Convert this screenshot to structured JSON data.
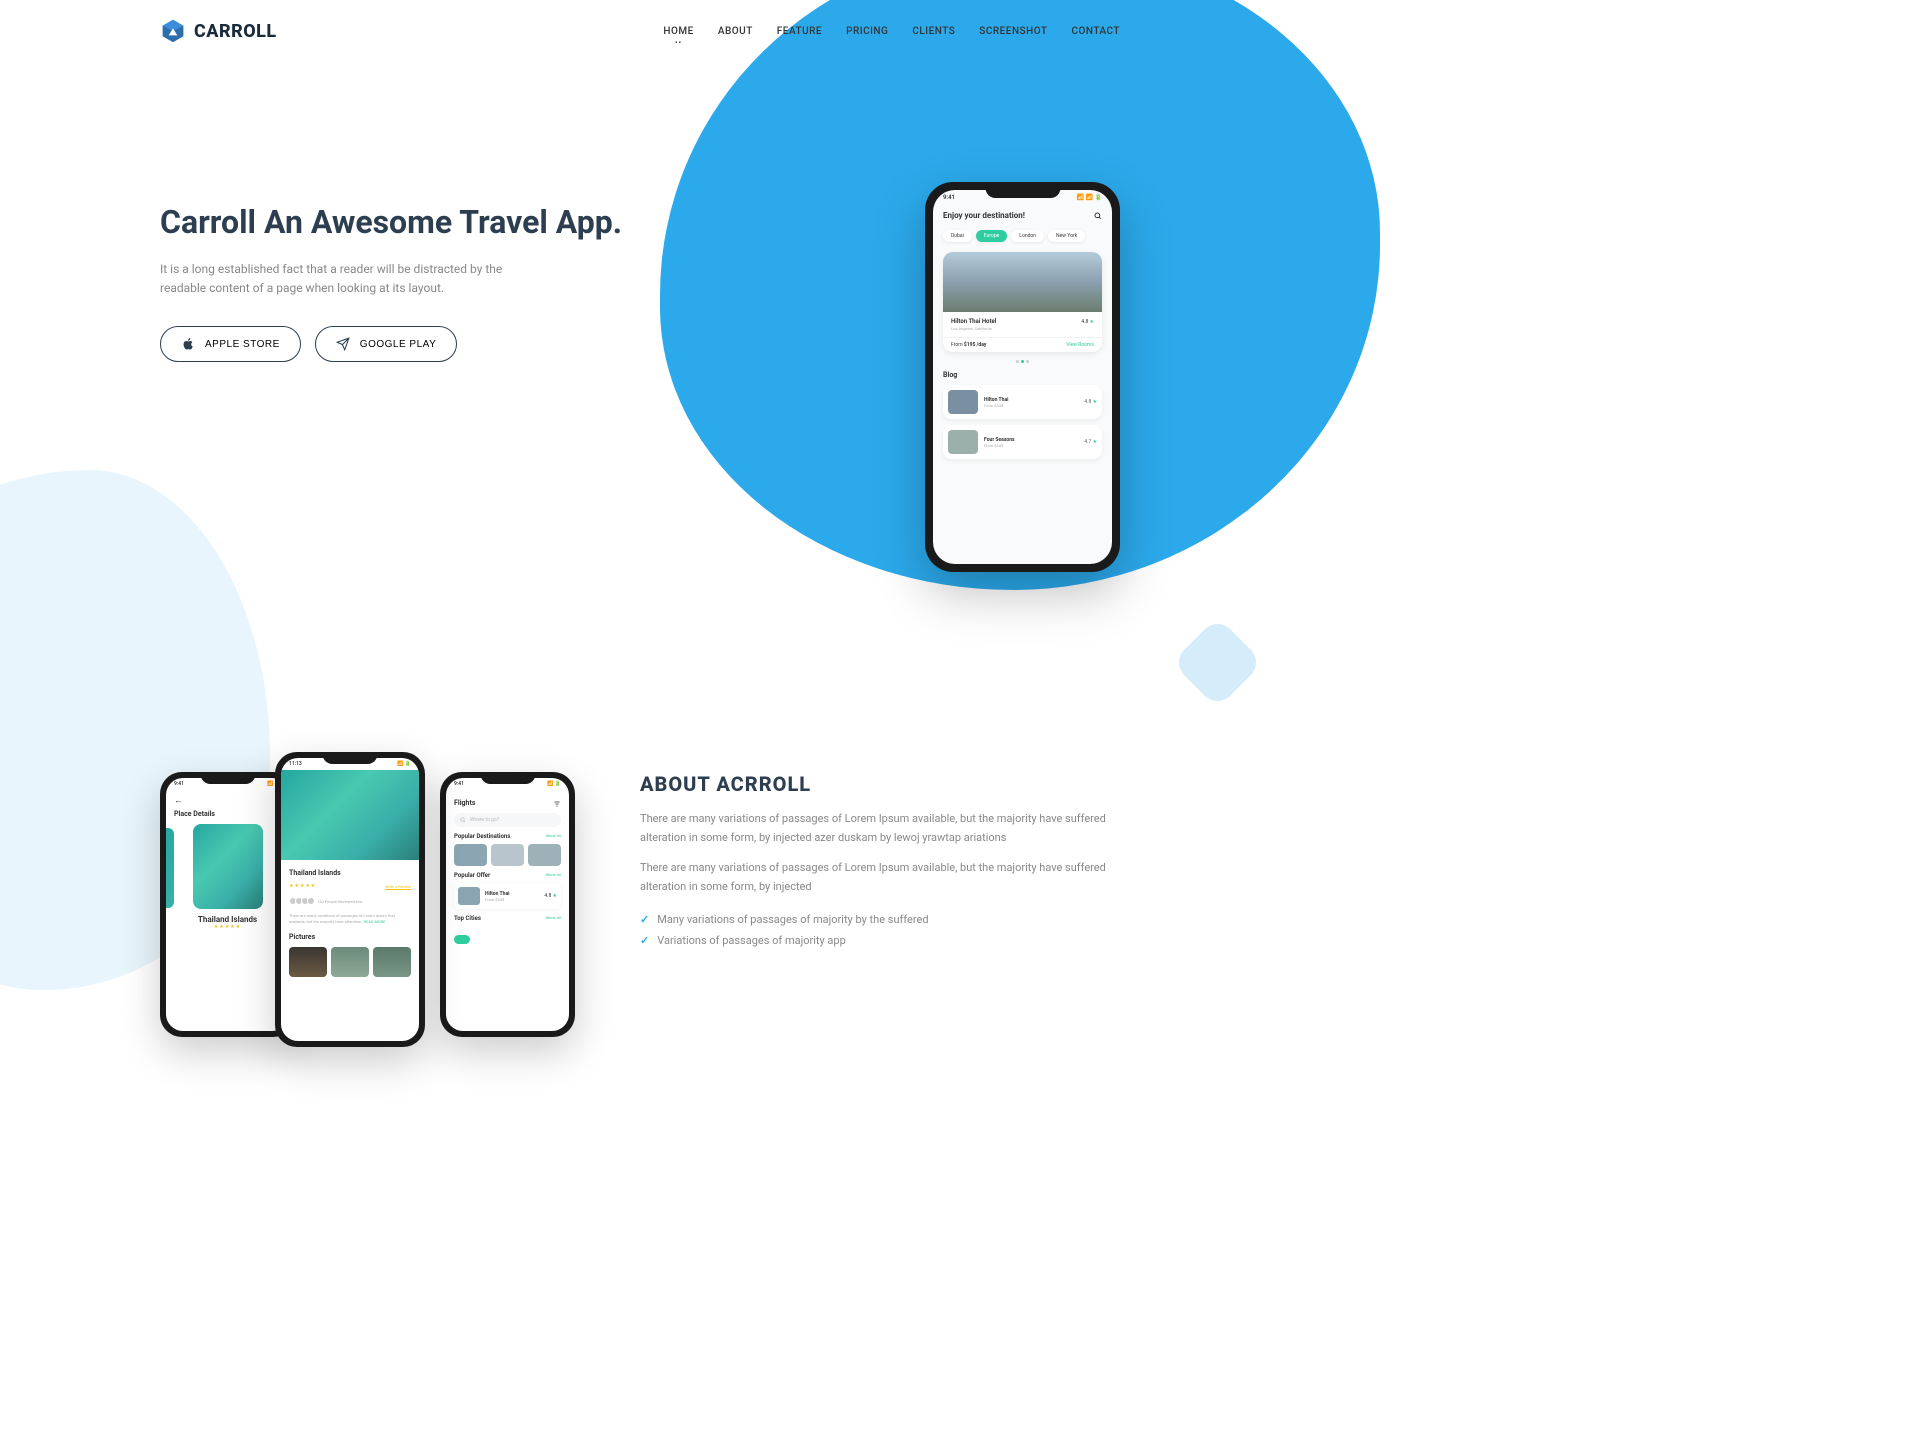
{
  "brand": "CARROLL",
  "nav": {
    "items": [
      "HOME",
      "ABOUT",
      "FEATURE",
      "PRICING",
      "CLIENTS",
      "SCREENSHOT",
      "CONTACT"
    ],
    "active": 0
  },
  "hero": {
    "title": "Carroll An Awesome Travel App.",
    "subtitle": "It is a long established fact that a reader will be distracted by the readable content of a page when looking at its layout.",
    "btn_apple": "APPLE STORE",
    "btn_google": "GOOGLE PLAY"
  },
  "phone1": {
    "time": "9:41",
    "heading": "Enjoy your destination!",
    "tabs": [
      "Dubai",
      "Europe",
      "London",
      "New York"
    ],
    "card": {
      "title": "Hilton Thai Hotel",
      "location": "Los Angeles, California",
      "rating": "4.8",
      "price_label": "From",
      "price": "$195 /day",
      "action": "View Rooms"
    },
    "blog_label": "Blog",
    "blog": [
      {
        "title": "Hilton Thai",
        "price": "From $345",
        "rating": "4.8"
      },
      {
        "title": "Four Seasons",
        "price": "From $345",
        "rating": "4.7"
      }
    ]
  },
  "about": {
    "title": "ABOUT ACRROLL",
    "p1": "There are many variations of passages of Lorem Ipsum available, but the majority have suffered alteration in some form, by injected azer duskam by lewoj yrawtap ariations",
    "p2": "There are many variations of passages of Lorem Ipsum available, but the majority have suffered alteration in some form, by injected",
    "items": [
      "Many variations of passages of majority by the suffered",
      "Variations of passages of majority app"
    ]
  },
  "phone_a1": {
    "time": "9:41",
    "heading": "Place Details",
    "title": "Thailand Islands"
  },
  "phone_a2": {
    "time": "11:13",
    "title": "Thailand Islands",
    "review_link": "Write a Review",
    "review_count": "130 People Reviewed this",
    "desc": "There are many variations of passages of Lorem Ipsum that available, but the majority have alteration.",
    "read_more": "READ MORE",
    "pictures_label": "Pictures"
  },
  "phone_a3": {
    "time": "9:41",
    "flights": "Flights",
    "search_placeholder": "Where to go?",
    "popular_dest": "Popular Destinations",
    "popular_offer": "Popular Offer",
    "show_all": "Show All",
    "offer": {
      "title": "Hilton Thai",
      "price": "From $345",
      "rating": "4.8"
    },
    "top_cities": "Top Cities"
  }
}
